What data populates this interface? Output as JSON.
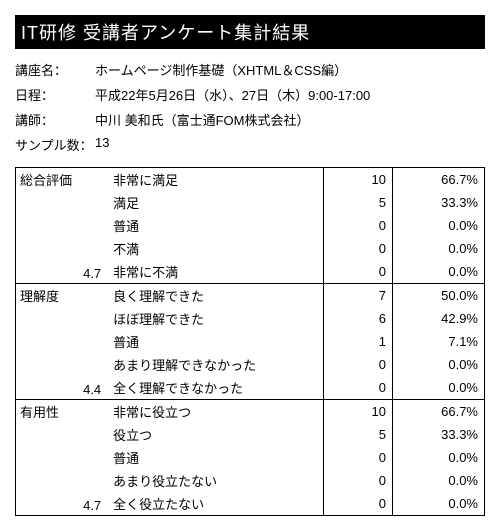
{
  "title": "IT研修  受講者アンケート集計結果",
  "meta": {
    "course_label": "講座名：",
    "course_value": "ホームページ制作基礎（XHTML＆CSS編）",
    "date_label": "日程：",
    "date_value": "平成22年5月26日（水）、27日（木）9:00-17:00",
    "instructor_label": "講師：",
    "instructor_value": "中川  美和氏（富士通FOM株式会社）",
    "sample_label": "サンプル数：",
    "sample_value": "13"
  },
  "sections": [
    {
      "label": "総合評価",
      "score": "4.7",
      "rows": [
        {
          "name": "非常に満足",
          "count": "10",
          "pct": "66.7%"
        },
        {
          "name": "満足",
          "count": "5",
          "pct": "33.3%"
        },
        {
          "name": "普通",
          "count": "0",
          "pct": "0.0%"
        },
        {
          "name": "不満",
          "count": "0",
          "pct": "0.0%"
        },
        {
          "name": "非常に不満",
          "count": "0",
          "pct": "0.0%"
        }
      ]
    },
    {
      "label": "理解度",
      "score": "4.4",
      "rows": [
        {
          "name": "良く理解できた",
          "count": "7",
          "pct": "50.0%"
        },
        {
          "name": "ほぼ理解できた",
          "count": "6",
          "pct": "42.9%"
        },
        {
          "name": "普通",
          "count": "1",
          "pct": "7.1%"
        },
        {
          "name": "あまり理解できなかった",
          "count": "0",
          "pct": "0.0%"
        },
        {
          "name": "全く理解できなかった",
          "count": "0",
          "pct": "0.0%"
        }
      ]
    },
    {
      "label": "有用性",
      "score": "4.7",
      "rows": [
        {
          "name": "非常に役立つ",
          "count": "10",
          "pct": "66.7%"
        },
        {
          "name": "役立つ",
          "count": "5",
          "pct": "33.3%"
        },
        {
          "name": "普通",
          "count": "0",
          "pct": "0.0%"
        },
        {
          "name": "あまり役立たない",
          "count": "0",
          "pct": "0.0%"
        },
        {
          "name": "全く役立たない",
          "count": "0",
          "pct": "0.0%"
        }
      ]
    }
  ]
}
